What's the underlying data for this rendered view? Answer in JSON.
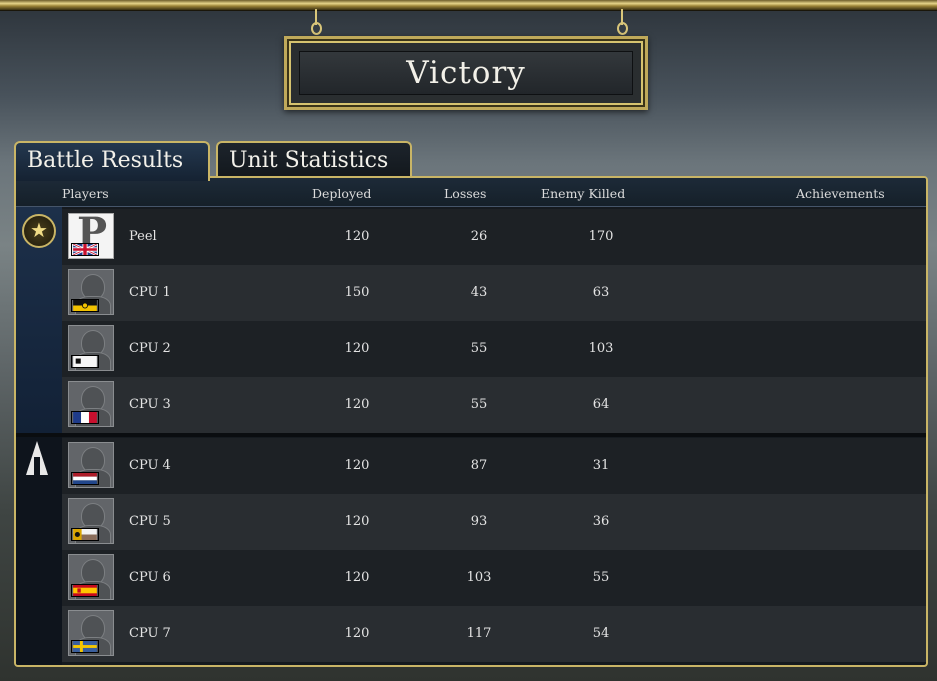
{
  "banner": {
    "title": "Victory"
  },
  "tabs": [
    {
      "label": "Battle Results",
      "active": true
    },
    {
      "label": "Unit Statistics",
      "active": false
    }
  ],
  "table": {
    "headers": {
      "players": "Players",
      "deployed": "Deployed",
      "losses": "Losses",
      "killed": "Enemy Killed",
      "achievements": "Achievements"
    },
    "team_a_emblem": "star-emblem-icon",
    "team_b_emblem": "spearhead-emblem-icon",
    "team_a": [
      {
        "name": "Peel",
        "deployed": "120",
        "losses": "26",
        "killed": "170",
        "flag": "great-britain-flag-icon"
      },
      {
        "name": "CPU 1",
        "deployed": "150",
        "losses": "43",
        "killed": "63",
        "flag": "austria-flag-icon"
      },
      {
        "name": "CPU 2",
        "deployed": "120",
        "losses": "55",
        "killed": "103",
        "flag": "prussia-flag-icon"
      },
      {
        "name": "CPU 3",
        "deployed": "120",
        "losses": "55",
        "killed": "64",
        "flag": "france-flag-icon"
      }
    ],
    "team_b": [
      {
        "name": "CPU 4",
        "deployed": "120",
        "losses": "87",
        "killed": "31",
        "flag": "netherlands-flag-icon"
      },
      {
        "name": "CPU 5",
        "deployed": "120",
        "losses": "93",
        "killed": "36",
        "flag": "russia-flag-icon"
      },
      {
        "name": "CPU 6",
        "deployed": "120",
        "losses": "103",
        "killed": "55",
        "flag": "spain-flag-icon"
      },
      {
        "name": "CPU 7",
        "deployed": "120",
        "losses": "117",
        "killed": "54",
        "flag": "sweden-flag-icon"
      }
    ]
  },
  "colors": {
    "gold_frame": "#c9b566",
    "team_a_bg": "#1d304a",
    "panel_bg": "#151a1f"
  }
}
